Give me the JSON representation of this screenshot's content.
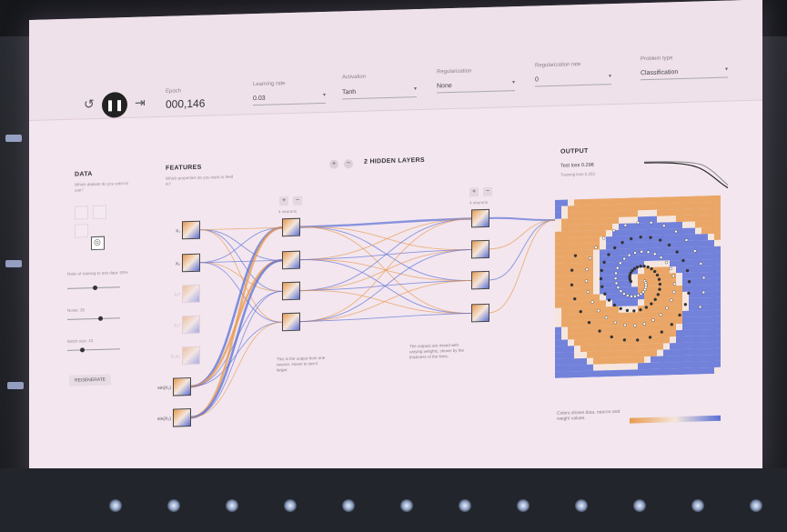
{
  "controls": {
    "epoch_value": "000,146"
  },
  "panels": {
    "data_title": "DATA",
    "features_title": "FEATURES",
    "hidden_title": "2 HIDDEN LAYERS",
    "output_title": "OUTPUT"
  },
  "features": {
    "items": [
      {
        "label": "X₁"
      },
      {
        "label": "X₂"
      },
      {
        "label": "X₁²"
      },
      {
        "label": "X₂²"
      },
      {
        "label": "X₁X₂"
      },
      {
        "label": "sin(X₁)"
      },
      {
        "label": "sin(X₂)"
      }
    ]
  },
  "output": {
    "test_loss": "Test loss 0.298"
  },
  "colors": {
    "positive": "#5a6fd6",
    "negative": "#e79a4f",
    "neutral": "#f4e6dc"
  }
}
